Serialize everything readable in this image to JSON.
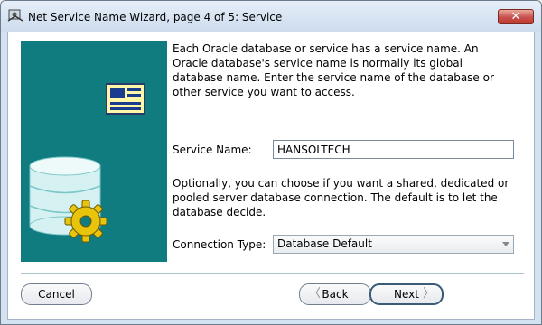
{
  "window": {
    "title": "Net Service Name Wizard, page 4 of 5: Service",
    "close_glyph": "✕"
  },
  "content": {
    "intro_text": "Each Oracle database or service has a service name. An Oracle database's service name is normally its global database name. Enter the service name of the database or other service you want to access.",
    "service_name": {
      "label": "Service Name:",
      "value": "HANSOLTECH"
    },
    "optional_text": "Optionally, you can choose if you want a shared, dedicated or pooled server database connection. The default is to let the database decide.",
    "connection_type": {
      "label": "Connection Type:",
      "value": "Database Default"
    }
  },
  "buttons": {
    "cancel": "Cancel",
    "back": "Back",
    "next": "Next",
    "back_glyph": "〈",
    "next_glyph": "〉"
  },
  "colors": {
    "panel_bg": "#117c7f",
    "disk": "#d6f1f2",
    "gear": "#e8c40c",
    "note_card": "#fff6a8"
  },
  "icons": {
    "app": "network-wizard-icon",
    "note": "index-card-icon",
    "database": "database-disk-stack-icon",
    "gear": "gear-icon"
  }
}
